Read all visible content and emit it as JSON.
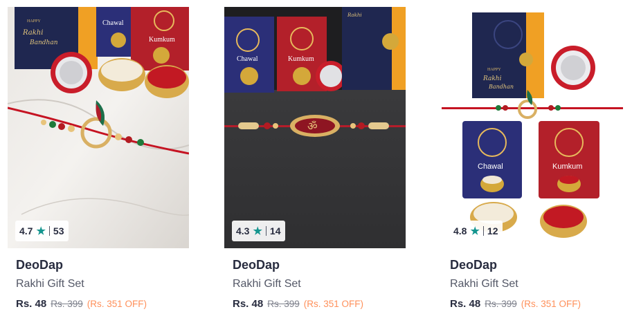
{
  "products": [
    {
      "brand": "DeoDap",
      "title": "Rakhi Gift Set",
      "rating": "4.7",
      "rating_count": "53",
      "price": "Rs. 48",
      "mrp": "Rs. 399",
      "discount": "(Rs. 351 OFF)"
    },
    {
      "brand": "DeoDap",
      "title": "Rakhi Gift Set",
      "rating": "4.3",
      "rating_count": "14",
      "price": "Rs. 48",
      "mrp": "Rs. 399",
      "discount": "(Rs. 351 OFF)"
    },
    {
      "brand": "DeoDap",
      "title": "Rakhi Gift Set",
      "rating": "4.8",
      "rating_count": "12",
      "price": "Rs. 48",
      "mrp": "Rs. 399",
      "discount": "(Rs. 351 OFF)"
    }
  ],
  "image_text": {
    "card_happy": "HAPPY",
    "card_rakhi": "Rakhi",
    "card_bandhan": "Bandhan",
    "packet_chawal": "Chawal",
    "packet_kumkum": "Kumkum"
  },
  "icons": {
    "rating": "star-icon"
  },
  "colors": {
    "star": "#14958f",
    "discount": "#ff905a",
    "text": "#282c3f",
    "muted": "#535766"
  }
}
